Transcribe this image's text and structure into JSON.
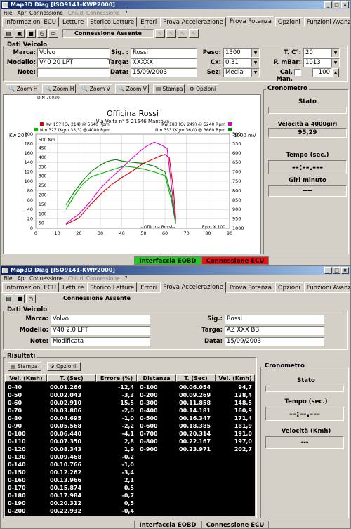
{
  "w1": {
    "title": "Map3D Diag [ISO9141-KWP2000]",
    "menu": [
      "File",
      "Apri Connessione",
      "Chiudi Connessione",
      "?"
    ],
    "tabs": [
      "Informazioni ECU",
      "Letture",
      "Storico Letture",
      "Errori",
      "Prova Accelerazione",
      "Prova Potenza",
      "Opzioni",
      "Funzioni Avanzate"
    ],
    "conn": "Connessione Assente",
    "dv_title": "Dati Veicolo",
    "marca_l": "Marca:",
    "marca": "Volvo",
    "modello_l": "Modello:",
    "modello": "V40 20 LPT",
    "note_l": "Note:",
    "sig_l": "Sig. :",
    "sig": "Rossi",
    "targa_l": "Targa:",
    "targa": "XXXXX",
    "data_l": "Data:",
    "data": "15/09/2003",
    "peso_l": "Peso:",
    "peso": "1300",
    "cx_l": "Cx:",
    "cx": "0,31",
    "sez_l": "Sez:",
    "sez": "Media",
    "tc_l": "T. C°:",
    "tc": "20",
    "pm_l": "P. mBar:",
    "pm": "1013",
    "cal_l": "Cal. Man.",
    "cal": "100",
    "zoom": [
      "Zoom H",
      "Zoom H",
      "Zoom V",
      "Zoom V"
    ],
    "stampa": "Stampa",
    "opzioni": "Opzioni",
    "cron": "Cronometro",
    "stato": "Stato",
    "vel4000": "Velocità a 4000giri",
    "vel4000_v": "95,29",
    "tempo": "Tempo (sec.)",
    "tempo_v": "--:--.---",
    "giri": "Giri minuto",
    "giri_v": "----",
    "st1": "Interfaccia EOBD",
    "st2": "Connessione ECU"
  },
  "chart": {
    "din": "DIN 70020",
    "shop": "Officina Rossi",
    "addr": "Via Volta n° 5 21546 Mantova",
    "leg1": "Kw 157 (Cv 214) @ 5640 Rpm",
    "leg2": "Nm 327 (Kgm 33,3) @ 4080 Rpm",
    "leg3": "Kw 183 (Cv 249) @ 5240 Rpm",
    "leg4": "Nm 353 (Kgm 36,0) @ 3660 Rpm",
    "kw": "Kw 200",
    "nm": "500 Nm",
    "mv": "1000 mV",
    "rpm": "Rpm X 100",
    "watermark": "--Officina Rossi--"
  },
  "chart_data": {
    "type": "line",
    "xlabel": "Rpm X 100",
    "xlim": [
      0,
      90
    ],
    "ylim": [
      0,
      200
    ],
    "x_ticks": [
      0,
      10,
      20,
      30,
      40,
      50,
      60,
      70,
      80,
      90
    ],
    "y_ticks": [
      0,
      20,
      40,
      60,
      80,
      100,
      120,
      140,
      160,
      180,
      200
    ],
    "y2_ticks": [
      1000,
      950,
      900,
      850,
      800,
      750,
      700,
      650,
      600,
      550,
      500
    ],
    "y3_ticks": [
      500,
      450,
      400,
      350,
      300,
      250,
      200,
      150,
      100,
      50
    ],
    "series": [
      {
        "name": "Kw 157 (Cv 214) @ 5640 Rpm",
        "color": "#dd0000",
        "x": [
          14,
          20,
          25,
          30,
          35,
          40,
          45,
          50,
          55,
          58,
          60,
          62,
          64,
          65
        ],
        "y": [
          8,
          22,
          48,
          72,
          92,
          108,
          122,
          138,
          148,
          154,
          157,
          150,
          80,
          20
        ]
      },
      {
        "name": "Nm 327 (Kgm 33,3) @ 4080 Rpm",
        "color": "#00bb00",
        "x": [
          14,
          18,
          22,
          26,
          30,
          34,
          38,
          41,
          45,
          50,
          55,
          60,
          63,
          65
        ],
        "y": [
          40,
          70,
          95,
          110,
          116,
          122,
          128,
          132,
          130,
          126,
          120,
          112,
          60,
          10
        ]
      },
      {
        "name": "Kw 183 (Cv 249) @ 5240 Rpm",
        "color": "#dd00dd",
        "x": [
          14,
          20,
          25,
          30,
          35,
          40,
          45,
          50,
          52,
          55,
          58,
          61,
          63,
          65
        ],
        "y": [
          10,
          30,
          55,
          85,
          108,
          128,
          150,
          170,
          176,
          183,
          178,
          170,
          90,
          15
        ]
      },
      {
        "name": "Nm 353 (Kgm 36,0) @ 3660 Rpm",
        "color": "#008800",
        "x": [
          14,
          18,
          22,
          26,
          30,
          33,
          37,
          40,
          45,
          50,
          55,
          60,
          63,
          65
        ],
        "y": [
          50,
          78,
          102,
          122,
          134,
          142,
          146,
          143,
          140,
          138,
          132,
          120,
          70,
          10
        ]
      }
    ]
  },
  "w2": {
    "title": "Map3D Diag [ISO9141-KWP2000]",
    "menu": [
      "File",
      "Apri Connessione",
      "Chiudi Connessione",
      "?"
    ],
    "tabs": [
      "Informazioni ECU",
      "Letture",
      "Storico Letture",
      "Errori",
      "Prova Accelerazione",
      "Prova Potenza",
      "Opzioni",
      "Funzioni Avanzate"
    ],
    "conn": "Connessione Assente",
    "dv_title": "Dati Veicolo",
    "marca_l": "Marca:",
    "marca": "Volvo",
    "modello_l": "Modello:",
    "modello": "V40 2.0 LPT",
    "note_l": "Note:",
    "note": "Modificata",
    "sig_l": "Sig.:",
    "sig": "Rossi",
    "targa_l": "Targa:",
    "targa": "AZ XXX BB",
    "data_l": "Data:",
    "data": "15/09/2003",
    "ris": "Risultati",
    "stampa": "Stampa",
    "opzioni": "Opzioni",
    "h": [
      "Vel. (Kmh)",
      "T. (Sec)",
      "Errore (%)",
      "Distanza (m)",
      "T. (Sec)",
      "Vel. (Kmh)"
    ],
    "left": [
      [
        "0-40",
        "00.01.266",
        "-12,4"
      ],
      [
        "0-50",
        "00.02.043",
        "-3,3"
      ],
      [
        "0-60",
        "00.02.910",
        "15,5"
      ],
      [
        "0-70",
        "00.03.806",
        "-2,0"
      ],
      [
        "0-80",
        "00.04.695",
        "-1,0"
      ],
      [
        "0-90",
        "00.05.568",
        "-2,2"
      ],
      [
        "0-100",
        "00.06.440",
        "-4,1"
      ],
      [
        "0-110",
        "00.07.350",
        "2,8"
      ],
      [
        "0-120",
        "00.08.343",
        "1,9"
      ],
      [
        "0-130",
        "00.09.468",
        "-0,2"
      ],
      [
        "0-140",
        "00.10.766",
        "-1,0"
      ],
      [
        "0-150",
        "00.12.262",
        "-3,4"
      ],
      [
        "0-160",
        "00.13.966",
        "2,1"
      ],
      [
        "0-170",
        "00.15.874",
        "0,5"
      ],
      [
        "0-180",
        "00.17.984",
        "-0,7"
      ],
      [
        "0-190",
        "00.20.312",
        "0,5"
      ],
      [
        "0-200",
        "00.22.932",
        "-0,4"
      ]
    ],
    "right": [
      [
        "0-100",
        "00.06.054",
        "94,7"
      ],
      [
        "0-200",
        "00.09.269",
        "128,4"
      ],
      [
        "0-300",
        "00.11.858",
        "148,5"
      ],
      [
        "0-400",
        "00.14.181",
        "160,9"
      ],
      [
        "0-500",
        "00.16.347",
        "171,4"
      ],
      [
        "0-600",
        "00.18.385",
        "181,9"
      ],
      [
        "0-700",
        "00.20.314",
        "191,0"
      ],
      [
        "0-800",
        "00.22.167",
        "197,0"
      ],
      [
        "0-900",
        "00.23.971",
        "202,7"
      ]
    ],
    "cron": "Cronometro",
    "stato": "Stato",
    "tempo": "Tempo (sec.)",
    "tempo_v": "--:--.---",
    "vel": "Velocità (Kmh)",
    "vel_v": "---",
    "st1": "Interfaccia EOBD",
    "st2": "Connessione ECU"
  }
}
